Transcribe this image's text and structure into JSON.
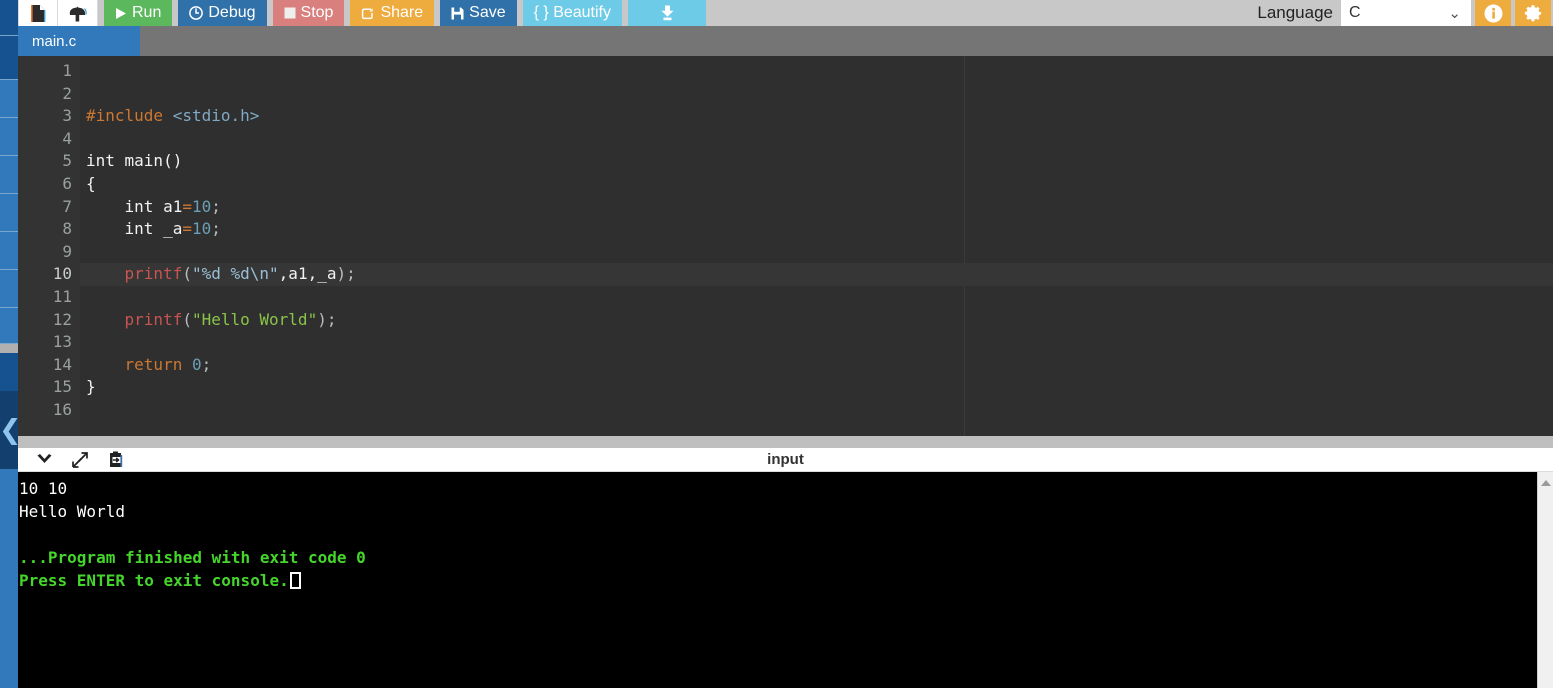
{
  "toolbar": {
    "new_file_icon": "new-file-icon",
    "upload_icon": "upload-icon",
    "run_label": "Run",
    "debug_label": "Debug",
    "stop_label": "Stop",
    "share_label": "Share",
    "save_label": "Save",
    "beautify_label": "{ } Beautify",
    "download_icon": "download-icon",
    "language_label": "Language",
    "language_value": "C",
    "info_icon": "info-icon",
    "settings_icon": "gear-icon"
  },
  "tabs": [
    {
      "label": "main.c",
      "active": true
    }
  ],
  "editor": {
    "line_numbers": [
      "1",
      "2",
      "3",
      "4",
      "5",
      "6",
      "7",
      "8",
      "9",
      "10",
      "11",
      "12",
      "13",
      "14",
      "15",
      "16"
    ],
    "active_line": 10,
    "fold_line": 6,
    "lines": [
      {
        "n": 1,
        "tokens": []
      },
      {
        "n": 2,
        "tokens": []
      },
      {
        "n": 3,
        "tokens": [
          {
            "t": "#include ",
            "c": "k-pre"
          },
          {
            "t": "<stdio.h>",
            "c": "k-inc"
          }
        ]
      },
      {
        "n": 4,
        "tokens": []
      },
      {
        "n": 5,
        "tokens": [
          {
            "t": "int main()",
            "c": "k-type"
          }
        ]
      },
      {
        "n": 6,
        "tokens": [
          {
            "t": "{",
            "c": "k-type"
          }
        ]
      },
      {
        "n": 7,
        "tokens": [
          {
            "t": "    int a1",
            "c": "k-type"
          },
          {
            "t": "=",
            "c": "k-pre"
          },
          {
            "t": "10",
            "c": "k-num"
          },
          {
            "t": ";",
            "c": "k-punct"
          }
        ]
      },
      {
        "n": 8,
        "tokens": [
          {
            "t": "    int _a",
            "c": "k-type"
          },
          {
            "t": "=",
            "c": "k-pre"
          },
          {
            "t": "10",
            "c": "k-num"
          },
          {
            "t": ";",
            "c": "k-punct"
          }
        ]
      },
      {
        "n": 9,
        "tokens": []
      },
      {
        "n": 10,
        "tokens": [
          {
            "t": "    printf",
            "c": "k-fn"
          },
          {
            "t": "(",
            "c": "k-punct"
          },
          {
            "t": "\"%d %d\\n\"",
            "c": "k-str"
          },
          {
            "t": ",a1,_a",
            "c": "k-var"
          },
          {
            "t": ");",
            "c": "k-punct"
          }
        ]
      },
      {
        "n": 11,
        "tokens": []
      },
      {
        "n": 12,
        "tokens": [
          {
            "t": "    printf",
            "c": "k-fn"
          },
          {
            "t": "(",
            "c": "k-punct"
          },
          {
            "t": "\"Hello World\"",
            "c": "k-strg"
          },
          {
            "t": ");",
            "c": "k-punct"
          }
        ]
      },
      {
        "n": 13,
        "tokens": []
      },
      {
        "n": 14,
        "tokens": [
          {
            "t": "    return ",
            "c": "k-ret"
          },
          {
            "t": "0",
            "c": "k-num"
          },
          {
            "t": ";",
            "c": "k-punct"
          }
        ]
      },
      {
        "n": 15,
        "tokens": [
          {
            "t": "}",
            "c": "k-type"
          }
        ]
      },
      {
        "n": 16,
        "tokens": []
      }
    ]
  },
  "console_toolbar": {
    "collapse_icon": "chevron-down-icon",
    "expand_icon": "expand-arrows-icon",
    "paste_icon": "paste-clipboard-icon",
    "input_label": "input"
  },
  "console": {
    "lines": [
      {
        "text": "10 10",
        "style": "o-white"
      },
      {
        "text": "Hello World",
        "style": "o-white"
      },
      {
        "text": "",
        "style": "o-white"
      },
      {
        "text": "...Program finished with exit code 0",
        "style": "o-green"
      },
      {
        "text": "Press ENTER to exit console.",
        "style": "o-green",
        "cursor": true
      }
    ]
  },
  "colors": {
    "toolbar_bg": "#c8c8c8",
    "tabstrip_bg": "#757575",
    "tab_active": "#3279bc",
    "editor_bg": "#2f2f2f",
    "gutter_bg": "#333333",
    "console_bg": "#000000",
    "accent_green": "#5cb85c",
    "accent_blue": "#3071a9",
    "accent_red": "#d9807f",
    "accent_orange": "#eeab3e",
    "accent_cyan": "#6ecbe8",
    "rail_blue": "#1b5b9e",
    "output_green": "#45d62b"
  }
}
